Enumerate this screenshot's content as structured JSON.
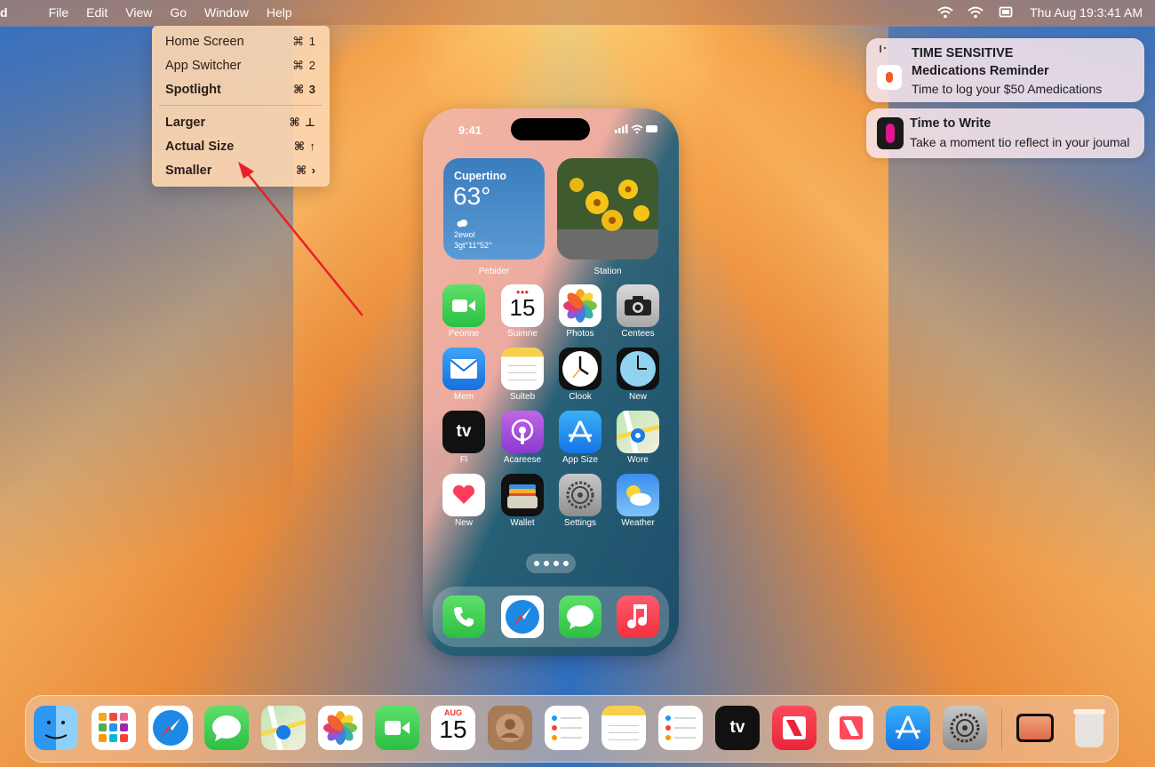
{
  "menubar": {
    "app_name": "d",
    "menus": [
      "File",
      "Edit",
      "View",
      "Go",
      "Window",
      "Help"
    ],
    "clock": "Thu Aug 19:3:41 AM",
    "status_icons": [
      "wifi-icon",
      "wifi-icon",
      "screen-mirroring-icon"
    ]
  },
  "dropdown": {
    "items": [
      {
        "label": "Home Screen",
        "shortcut": "⌘ 1",
        "bold": false
      },
      {
        "label": "App Switcher",
        "shortcut": "⌘ 2",
        "bold": false
      },
      {
        "label": "Spotlight",
        "shortcut": "⌘ 3",
        "bold": true
      },
      {
        "label": "Larger",
        "shortcut": "⌘ ⊥",
        "bold": true
      },
      {
        "label": "Actual Size",
        "shortcut": "⌘ ↑",
        "bold": true
      },
      {
        "label": "Smaller",
        "shortcut": "⌘ ›",
        "bold": true
      }
    ]
  },
  "notifications": [
    {
      "category": "TIME SENSITIVE",
      "title": "Medications Reminder",
      "body": "Time to log your $50 Amedications"
    },
    {
      "title": "Time to Write",
      "body": "Take a moment tio reflect in your joumal"
    }
  ],
  "phone": {
    "time": "9:41",
    "weather_widget": {
      "city": "Cupertino",
      "temp": "63°",
      "cond_line1": "2ewol",
      "cond_line2": "3gt°11°52°",
      "label": "Pebider"
    },
    "photo_widget": {
      "label": "Station"
    },
    "apps": [
      {
        "label": "Peonne",
        "icon": "facetime-icon"
      },
      {
        "label": "Suimne",
        "icon": "calendar-icon",
        "calendar_day": "15"
      },
      {
        "label": "Photos",
        "icon": "photos-icon"
      },
      {
        "label": "Centees",
        "icon": "camera-icon"
      },
      {
        "label": "Mem",
        "icon": "mail-icon"
      },
      {
        "label": "Sulteb",
        "icon": "notes-icon"
      },
      {
        "label": "Clook",
        "icon": "clock-icon"
      },
      {
        "label": "New",
        "icon": "clock-blue-icon"
      },
      {
        "label": "Fl",
        "icon": "apple-tv-icon",
        "text": "tv"
      },
      {
        "label": "Acareese",
        "icon": "podcasts-icon"
      },
      {
        "label": "App Size",
        "icon": "app-store-icon"
      },
      {
        "label": "Wore",
        "icon": "maps-icon"
      },
      {
        "label": "New",
        "icon": "health-icon"
      },
      {
        "label": "Wallet",
        "icon": "wallet-icon"
      },
      {
        "label": "Settings",
        "icon": "settings-icon"
      },
      {
        "label": "Weather",
        "icon": "weather-icon"
      }
    ],
    "dock": [
      "phone-icon",
      "safari-icon",
      "messages-icon",
      "music-icon"
    ]
  },
  "dock": {
    "calendar_day": "15",
    "calendar_month": "AUG",
    "tv_text": "tv",
    "items": [
      "finder-icon",
      "launchpad-icon",
      "safari-icon",
      "messages-icon",
      "maps-icon",
      "photos-icon",
      "facetime-icon",
      "calendar-icon",
      "contacts-icon",
      "reminders-icon",
      "notes-icon",
      "reminders-icon",
      "apple-tv-icon",
      "news-icon",
      "news-icon",
      "app-store-icon",
      "system-settings-icon",
      "simulator-icon",
      "trash-icon"
    ]
  },
  "colors": {
    "menubar": "#be7850",
    "dropdown_bg": "#fcd6b0",
    "arrow": "#e8202a"
  }
}
